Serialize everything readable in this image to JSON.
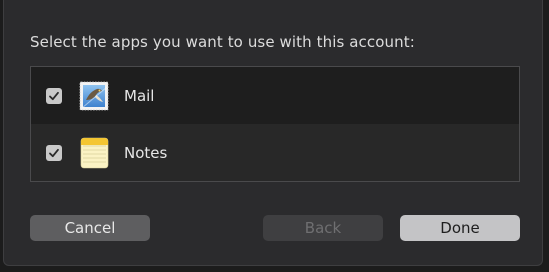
{
  "dialog": {
    "prompt": "Select the apps you want to use with this account:",
    "apps": [
      {
        "name": "Mail",
        "checked": true,
        "icon": "mail-icon"
      },
      {
        "name": "Notes",
        "checked": true,
        "icon": "notes-icon"
      }
    ],
    "buttons": {
      "cancel": "Cancel",
      "back": "Back",
      "done": "Done"
    }
  }
}
